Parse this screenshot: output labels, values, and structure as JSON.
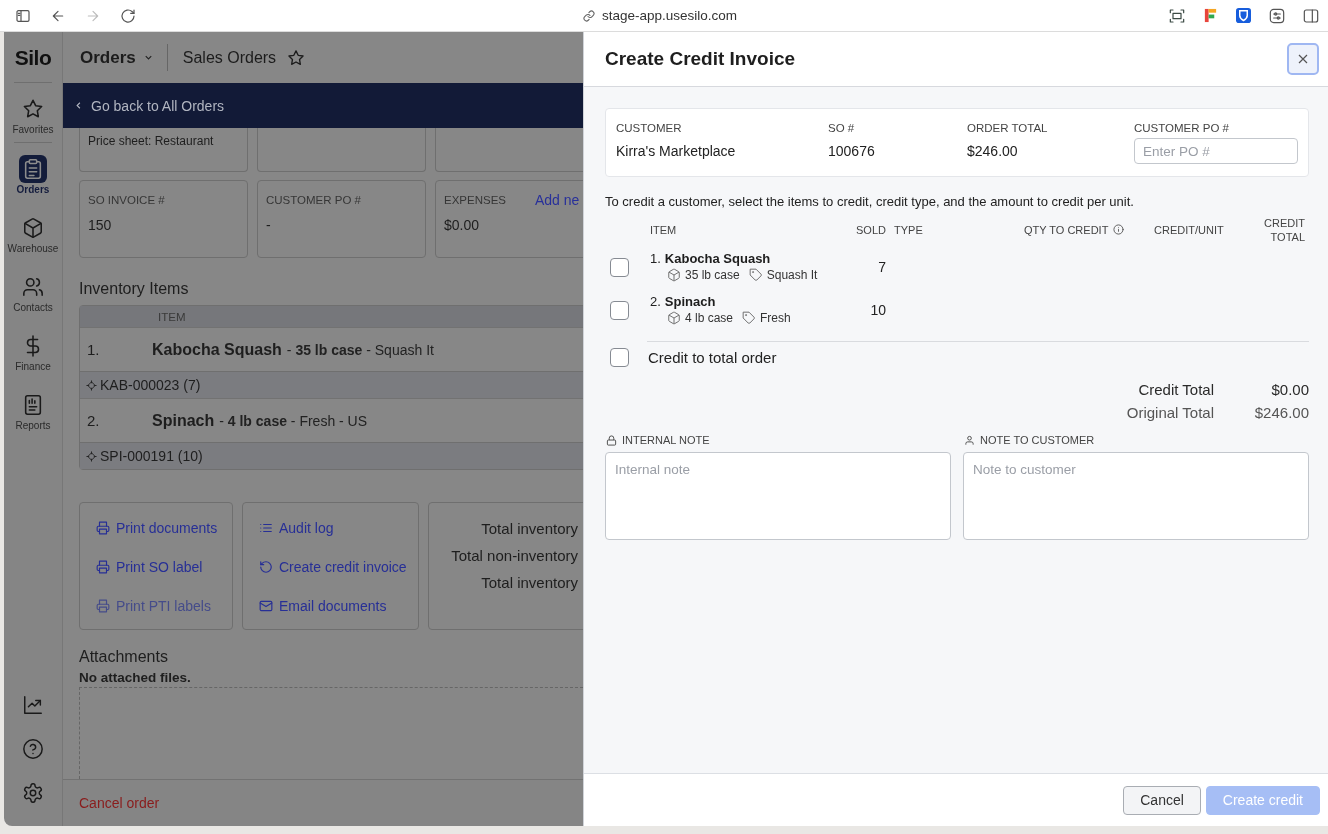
{
  "browser": {
    "url": "stage-app.usesilo.com",
    "forward_disabled": true
  },
  "sidebar": {
    "logo": "Silo",
    "items": [
      {
        "label": "Favorites",
        "selected": false
      },
      {
        "label": "Orders",
        "selected": true
      },
      {
        "label": "Warehouse",
        "selected": false
      },
      {
        "label": "Contacts",
        "selected": false
      },
      {
        "label": "Finance",
        "selected": false
      },
      {
        "label": "Reports",
        "selected": false
      }
    ]
  },
  "header": {
    "module": "Orders",
    "title": "Sales Orders",
    "favorite": false
  },
  "back_bar": {
    "label": "Go back to All Orders"
  },
  "price_sheet": "Price sheet: Restaurant",
  "fields": [
    {
      "label": "SO INVOICE #",
      "value": "150"
    },
    {
      "label": "CUSTOMER PO #",
      "value": "-"
    },
    {
      "label": "EXPENSES",
      "value": "$0.00",
      "link": "Add ne"
    }
  ],
  "inventory": {
    "title": "Inventory Items",
    "column": "ITEM",
    "rows": [
      {
        "number": "1.",
        "name": "Kabocha Squash",
        "details": "- **35 lb case** - Squash It",
        "lot": "KAB-000023 (7)"
      },
      {
        "number": "2.",
        "name": "Spinach",
        "details": "- **4 lb case** - Fresh - US",
        "lot": "SPI-000191 (10)"
      }
    ]
  },
  "action_groups": [
    {
      "links": [
        {
          "label": "Print documents",
          "disabled": false
        },
        {
          "label": "Print SO label",
          "disabled": false
        },
        {
          "label": "Print PTI labels",
          "disabled": true
        }
      ]
    },
    {
      "links": [
        {
          "label": "Audit log",
          "disabled": false
        },
        {
          "label": "Create credit invoice",
          "disabled": false
        },
        {
          "label": "Email documents",
          "disabled": false
        }
      ]
    }
  ],
  "totals_labels": [
    "Total inventory",
    "Total non-inventory",
    "Total inventory"
  ],
  "attachments": {
    "title": "Attachments",
    "empty_text": "No attached files."
  },
  "footer": {
    "cancel_label": "Cancel order"
  },
  "modal": {
    "title": "Create Credit Invoice",
    "summary": [
      {
        "label": "CUSTOMER",
        "value": "Kirra's Marketplace"
      },
      {
        "label": "SO #",
        "value": "100676"
      },
      {
        "label": "ORDER TOTAL",
        "value": "$246.00"
      }
    ],
    "po_field": {
      "label": "CUSTOMER PO #",
      "placeholder": "Enter PO #"
    },
    "instructions": "To credit a customer, select the items to credit, credit type, and the amount to credit per unit.",
    "columns": [
      {
        "label": "ITEM",
        "info": false
      },
      {
        "label": "SOLD",
        "info": false
      },
      {
        "label": "TYPE",
        "info": false
      },
      {
        "label": "QTY TO CREDIT",
        "info": true
      },
      {
        "label": "CREDIT/UNIT",
        "info": false
      },
      {
        "label": "CREDIT TOTAL",
        "info": false
      }
    ],
    "items": [
      {
        "number": "1.",
        "name": "Kabocha Squash",
        "pack": "35 lb case",
        "brand": "Squash It",
        "sold": "7",
        "checked": false
      },
      {
        "number": "2.",
        "name": "Spinach",
        "pack": "4 lb case",
        "brand": "Fresh",
        "sold": "10",
        "checked": false
      }
    ],
    "total_order": {
      "label": "Credit to total order",
      "checked": false
    },
    "totals": [
      {
        "label": "Credit Total",
        "value": "$0.00"
      },
      {
        "label": "Original Total",
        "value": "$246.00"
      }
    ],
    "notes": [
      {
        "label": "INTERNAL NOTE",
        "placeholder": "Internal note"
      },
      {
        "label": "NOTE TO CUSTOMER",
        "placeholder": "Note to customer"
      }
    ],
    "buttons": [
      {
        "label": "Cancel",
        "kind": "secondary",
        "disabled": false
      },
      {
        "label": "Create credit",
        "kind": "primary",
        "disabled": true
      }
    ]
  }
}
